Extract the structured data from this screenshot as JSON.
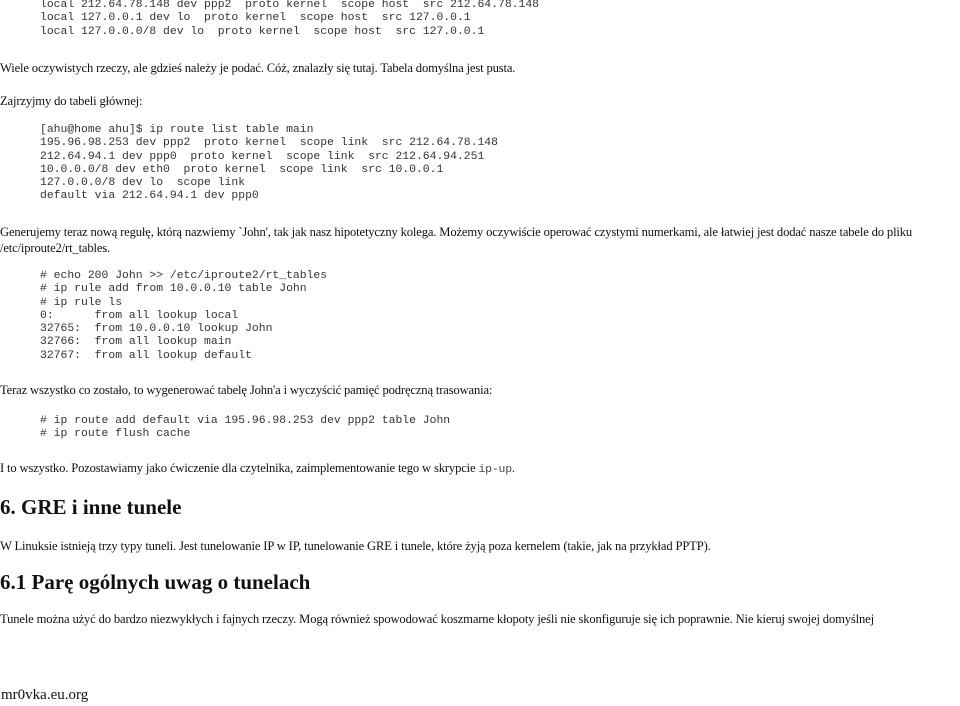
{
  "document": {
    "pre_top": [
      "local 212.64.78.148 dev ppp2  proto kernel  scope host  src 212.64.78.148",
      "local 127.0.0.1 dev lo  proto kernel  scope host  src 127.0.0.1",
      "local 127.0.0.0/8 dev lo  proto kernel  scope host  src 127.0.0.1"
    ],
    "para_default_empty": "Wiele oczywistych rzeczy, ale gdzieś należy je podać. Cóż, znalazły się tutaj. Tabela domyślna jest pusta.",
    "para_main_table": "Zajrzyjmy do tabeli głównej:",
    "pre_main": [
      "[ahu@home ahu]$ ip route list table main",
      "195.96.98.253 dev ppp2  proto kernel  scope link  src 212.64.78.148",
      "212.64.94.1 dev ppp0  proto kernel  scope link  src 212.64.94.251",
      "10.0.0.0/8 dev eth0  proto kernel  scope link  src 10.0.0.1",
      "127.0.0.0/8 dev lo  scope link",
      "default via 212.64.94.1 dev ppp0"
    ],
    "para_new_rule": "Generujemy teraz nową regułę, którą nazwiemy `John', tak jak nasz hipotetyczny kolega. Możemy oczywiście operować czystymi numerkami, ale łatwiej jest dodać nasze tabele do pliku /etc/iproute2/rt_tables.",
    "pre_rules": [
      "# echo 200 John >> /etc/iproute2/rt_tables",
      "# ip rule add from 10.0.0.10 table John",
      "# ip rule ls",
      "0:      from all lookup local",
      "32765:  from 10.0.0.10 lookup John",
      "32766:  from all lookup main",
      "32767:  from all lookup default"
    ],
    "para_remaining": "Teraz wszystko co zostało, to wygenerować tabelę John'a i wyczyścić pamięć podręczną trasowania:",
    "pre_route_add": [
      "# ip route add default via 195.96.98.253 dev ppp2 table John",
      "# ip route flush cache"
    ],
    "para_thats_all_before": "I to wszystko. Pozostawiamy jako ćwiczenie dla czytelnika, zaimplementowanie tego w skrypcie ",
    "para_thats_all_code": "ip-up",
    "para_thats_all_after": ".",
    "heading_6": "6. GRE i inne tunele",
    "para_tunnels_types": "W Linuksie istnieją trzy typy tuneli. Jest tunelowanie IP w IP, tunelowanie GRE i tunele, które żyją poza kernelem (takie, jak na przykład PPTP).",
    "heading_6_1": "6.1 Parę ogólnych uwag o tunelach",
    "para_tunnels_notes": "Tunele można użyć do bardzo niezwykłych i fajnych rzeczy. Mogą również spowodować koszmarne kłopoty jeśli nie skonfiguruje się ich poprawnie. Nie kieruj swojej domyślnej",
    "footer": "mr0vka.eu.org"
  }
}
